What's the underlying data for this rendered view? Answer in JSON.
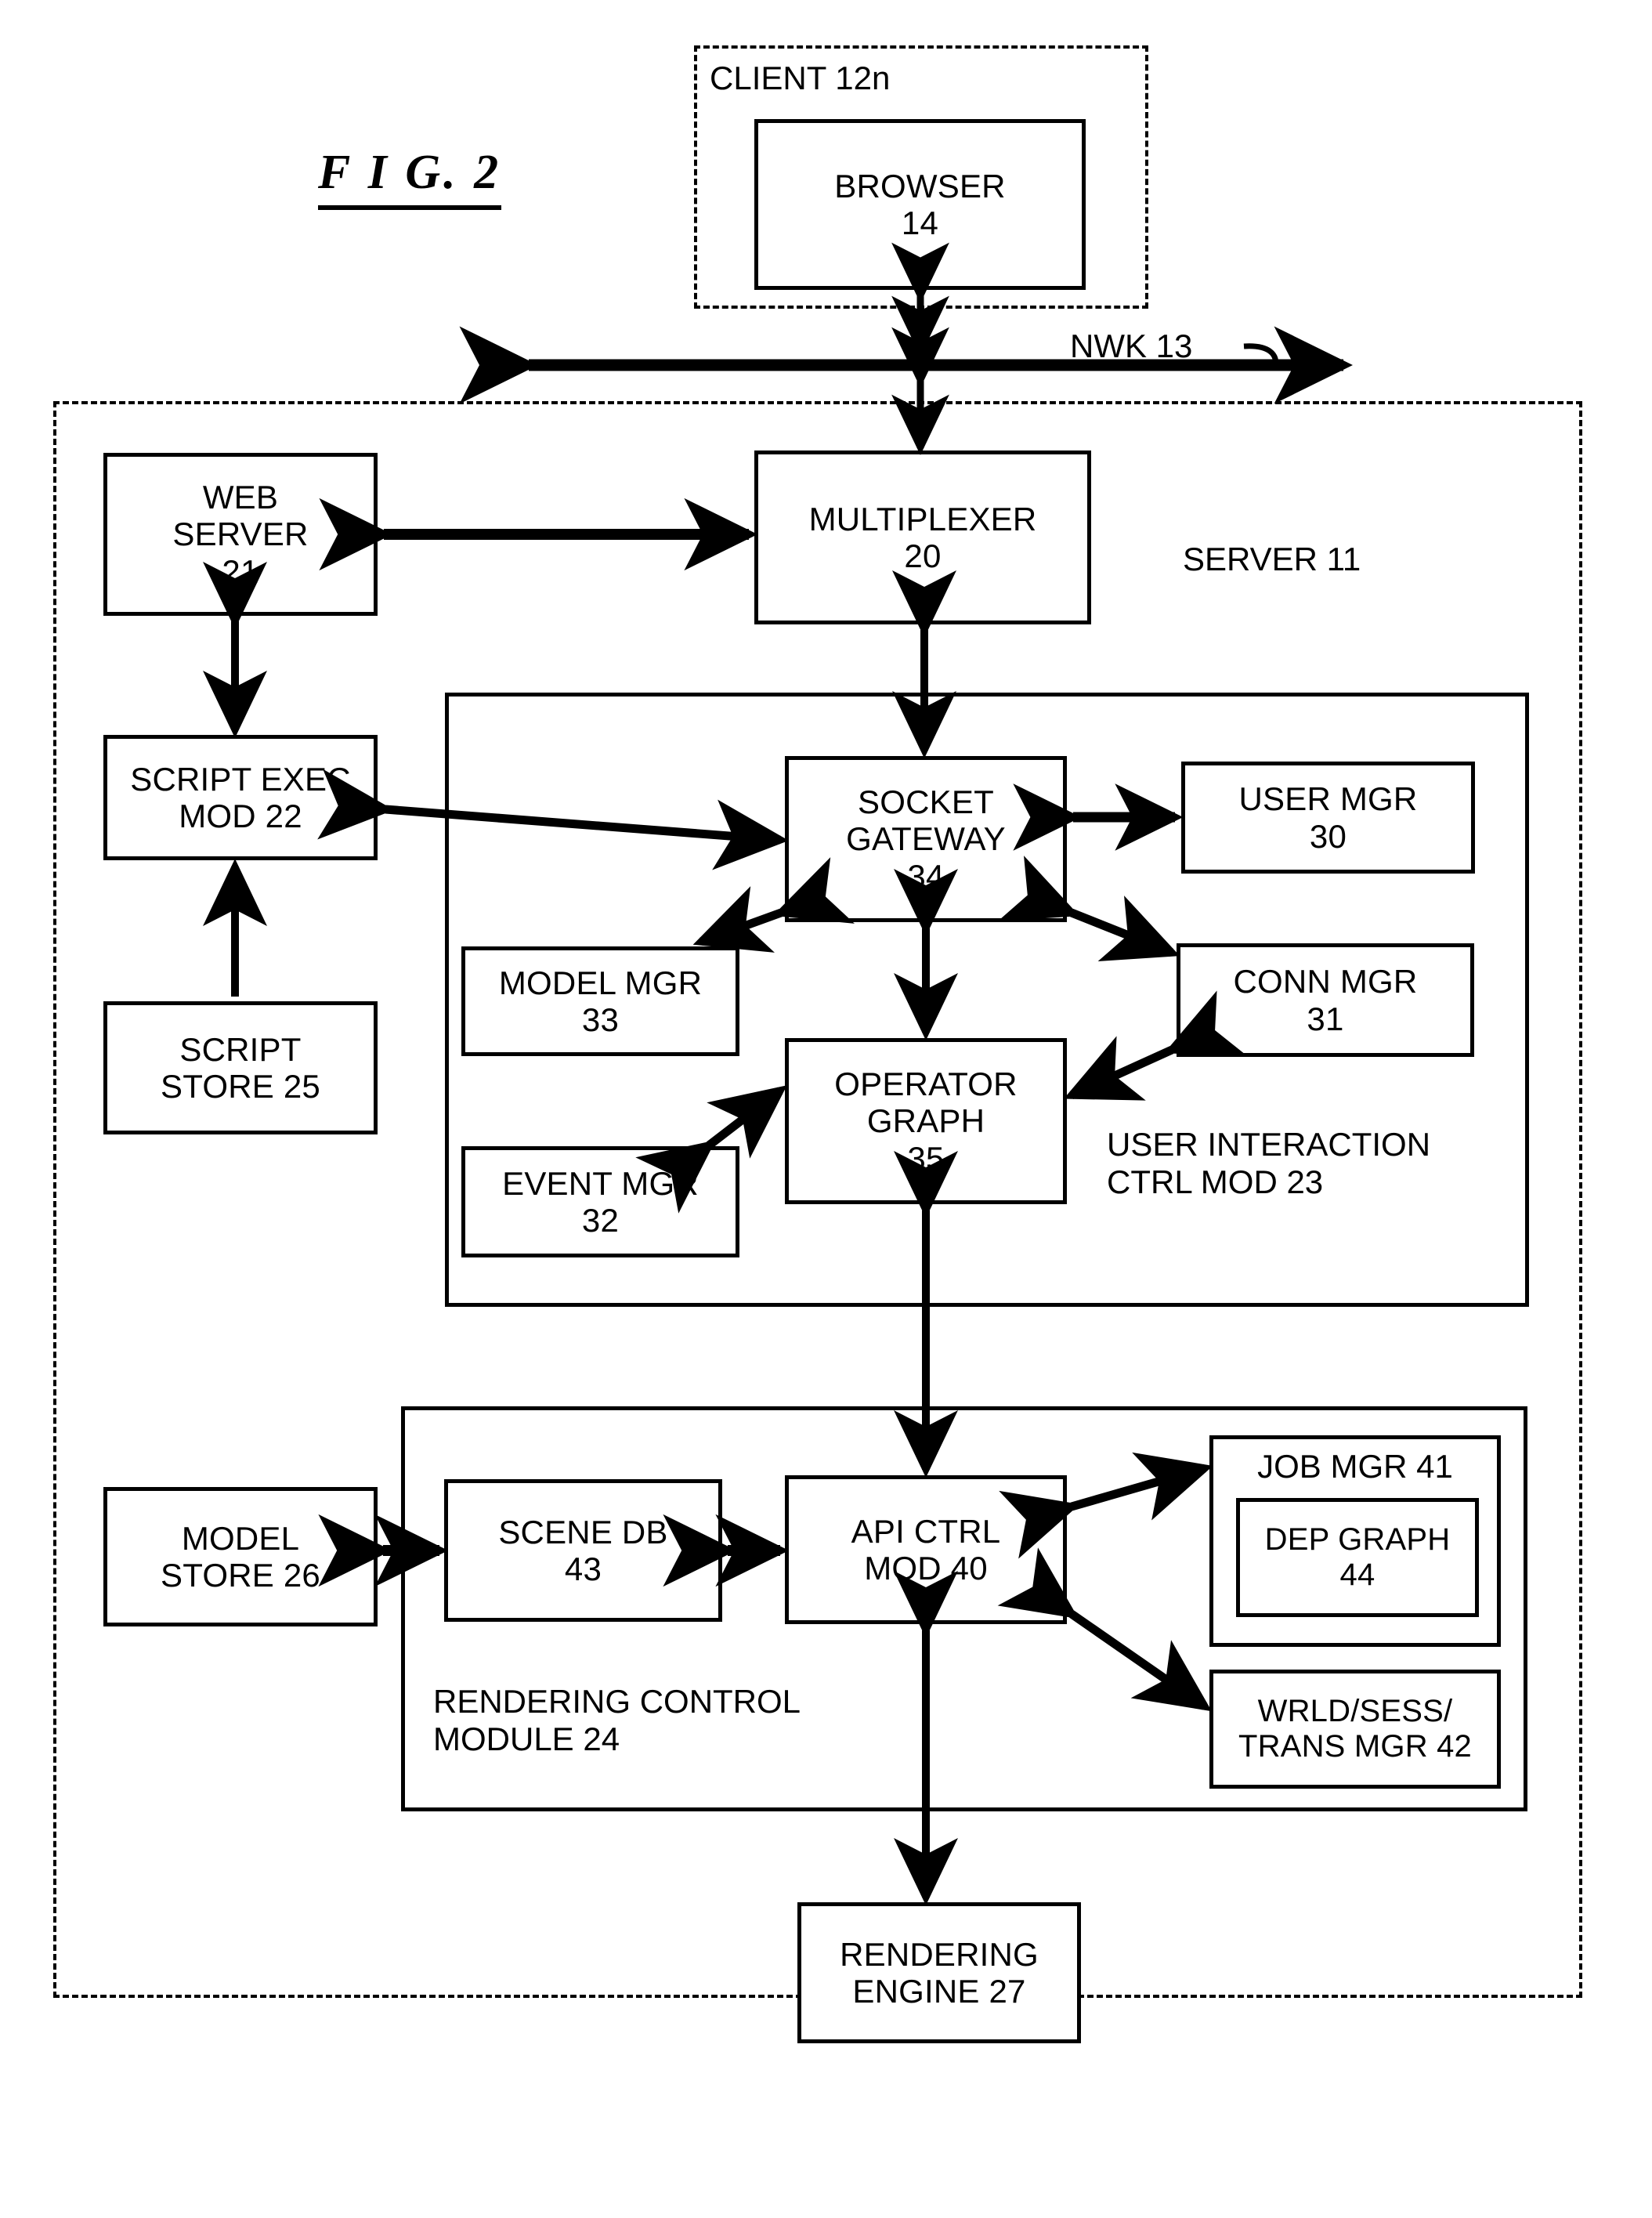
{
  "figure": {
    "label": "F I G. 2"
  },
  "client": {
    "title": "CLIENT 12n",
    "browser": "BROWSER\n14"
  },
  "network": {
    "label": "NWK 13"
  },
  "server": {
    "title": "SERVER 11",
    "web_server": "WEB\nSERVER\n21",
    "multiplexer": "MULTIPLEXER\n20",
    "script_exec_mod": "SCRIPT EXEC\nMOD 22",
    "script_store": "SCRIPT\nSTORE 25",
    "model_store": "MODEL\nSTORE 26",
    "rendering_engine": "RENDERING\nENGINE 27"
  },
  "user_interaction_ctrl_mod": {
    "title": "USER INTERACTION\nCTRL MOD 23",
    "socket_gateway": "SOCKET\nGATEWAY\n34",
    "user_mgr": "USER MGR\n30",
    "model_mgr": "MODEL MGR\n33",
    "conn_mgr": "CONN MGR\n31",
    "operator_graph": "OPERATOR\nGRAPH\n35",
    "event_mgr": "EVENT MGR\n32"
  },
  "rendering_control_module": {
    "title": "RENDERING CONTROL\nMODULE 24",
    "scene_db": "SCENE DB\n43",
    "api_ctrl_mod": "API CTRL\nMOD 40",
    "job_mgr": "JOB MGR 41",
    "dep_graph": "DEP GRAPH\n44",
    "wrld_sess_trans_mgr": "WRLD/SESS/\nTRANS MGR 42"
  }
}
